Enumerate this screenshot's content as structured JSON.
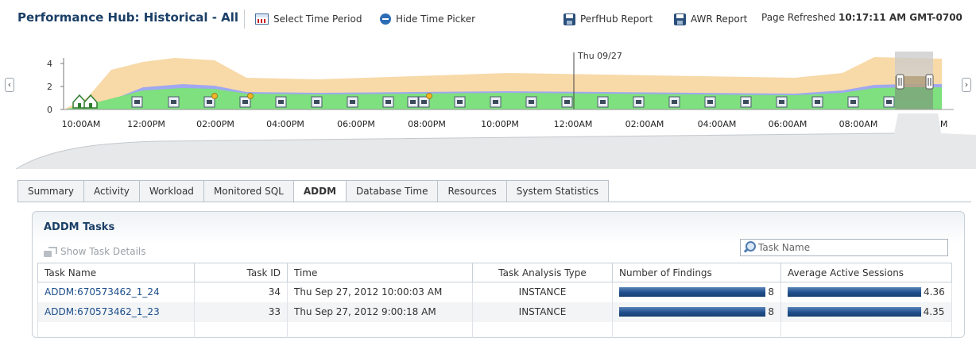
{
  "header": {
    "title": "Performance Hub: Historical - All",
    "select_time_period": "Select Time Period",
    "hide_time_picker": "Hide Time Picker",
    "perfhub_report": "PerfHub Report",
    "awr_report": "AWR Report",
    "page_refreshed_label": "Page Refreshed",
    "page_refreshed_time": "10:17:11 AM GMT-0700"
  },
  "timeline": {
    "y_ticks": [
      "4",
      "2",
      "0"
    ],
    "x_ticks": [
      "10:00AM",
      "12:00PM",
      "02:00PM",
      "04:00PM",
      "06:00PM",
      "08:00PM",
      "10:00PM",
      "12:00AM",
      "02:00AM",
      "04:00AM",
      "06:00AM",
      "08:00AM",
      "10:00AM"
    ],
    "day_marker": "Thu 09/27",
    "colors": {
      "cpu_wait": "#f8d9a8",
      "user_io": "#9fa8f0",
      "cpu": "#7ee07e",
      "selection": "#a58a5c"
    },
    "icons": [
      "snapshot-icon",
      "addm-report-icon",
      "baseline-start-icon"
    ]
  },
  "tabs": [
    {
      "label": "Summary",
      "active": false
    },
    {
      "label": "Activity",
      "active": false
    },
    {
      "label": "Workload",
      "active": false
    },
    {
      "label": "Monitored SQL",
      "active": false
    },
    {
      "label": "ADDM",
      "active": true
    },
    {
      "label": "Database Time",
      "active": false
    },
    {
      "label": "Resources",
      "active": false
    },
    {
      "label": "System Statistics",
      "active": false
    }
  ],
  "addm": {
    "title": "ADDM Tasks",
    "show_task_details": "Show Task Details",
    "search_placeholder": "Task Name",
    "columns": [
      "Task Name",
      "Task ID",
      "Time",
      "Task Analysis Type",
      "Number of Findings",
      "Average Active Sessions"
    ],
    "rows": [
      {
        "task_name": "ADDM:670573462_1_24",
        "task_id": "34",
        "time": "Thu Sep 27, 2012 10:00:03 AM",
        "type": "INSTANCE",
        "findings": "8",
        "findings_fraction": 1.0,
        "aas": "4.36",
        "aas_fraction": 1.0
      },
      {
        "task_name": "ADDM:670573462_1_23",
        "task_id": "33",
        "time": "Thu Sep 27, 2012 9:00:18 AM",
        "type": "INSTANCE",
        "findings": "8",
        "findings_fraction": 1.0,
        "aas": "4.35",
        "aas_fraction": 0.998
      }
    ]
  }
}
